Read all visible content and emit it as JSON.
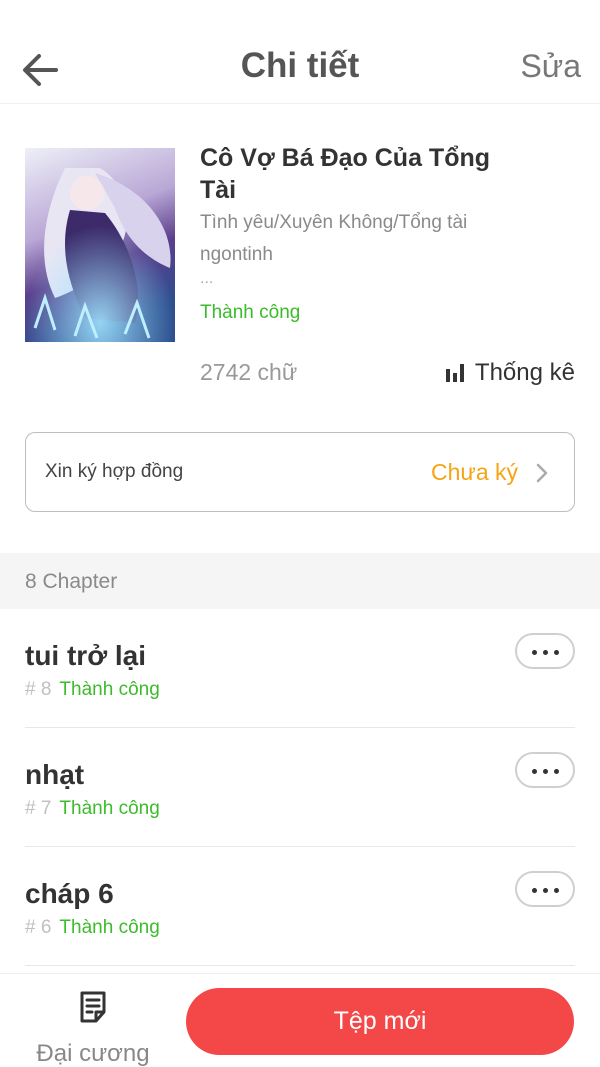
{
  "header": {
    "title": "Chi tiết",
    "edit_label": "Sửa"
  },
  "book": {
    "title": "Cô Vợ Bá Đạo Của Tổng Tài",
    "genre": "Tình yêu/Xuyên Không/Tổng tài",
    "author": "ngontinh",
    "ellipsis": "...",
    "status": "Thành công",
    "word_count": "2742 chữ",
    "stats_label": "Thống kê"
  },
  "contract": {
    "label": "Xin ký hợp đồng",
    "status": "Chưa ký"
  },
  "chapters": {
    "count_label": "8 Chapter",
    "items": [
      {
        "title": "tui trở lại",
        "number": "# 8",
        "status": "Thành công"
      },
      {
        "title": "nhạt",
        "number": "# 7",
        "status": "Thành công"
      },
      {
        "title": "cháp 6",
        "number": "# 6",
        "status": "Thành công"
      }
    ]
  },
  "bottom_bar": {
    "outline_label": "Đại cương",
    "new_chapter_label": "Tệp mới"
  },
  "colors": {
    "accent_red": "#f44848",
    "success_green": "#3cbb2b",
    "warning_orange": "#f5a414"
  },
  "icons": {
    "back": "arrow-left-icon",
    "stats": "bar-chart-icon",
    "contract_chevron": "chevron-right-icon",
    "chapter_menu": "more-horizontal-icon",
    "outline": "document-list-icon"
  }
}
